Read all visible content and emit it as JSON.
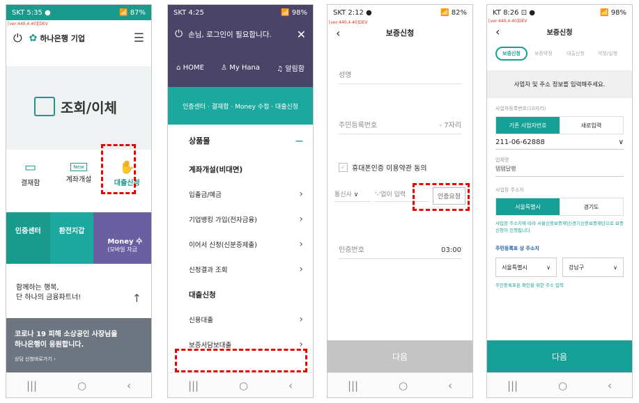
{
  "phone1": {
    "status": {
      "left": "SKT 5:35 ●",
      "right": "📶 87%"
    },
    "version": "[ver:440,4.40][DEV",
    "power_label": "⏻",
    "brand": "하나은행 기업",
    "menu_label": "☰",
    "hero_label": "조회/이체",
    "shortcuts": [
      "결재함",
      "계좌개설",
      "대출신청"
    ],
    "new_badge": "New",
    "tiles": [
      "인증센터",
      "환전지갑",
      "Money 수",
      "(모바일 자금"
    ],
    "slogan": [
      "함께하는 행복,",
      "단 하나의 금융파트너!"
    ],
    "up_label": "↑",
    "banner": [
      "코로나 19 피해 소상공인 사장님을",
      "하나은행이 응원합니다.",
      "상담 신청바로가기 ›"
    ]
  },
  "phone2": {
    "status": {
      "left": "SKT 4:25",
      "right": "📶 98%"
    },
    "login_msg": "손님, 로그인이 필요합니다.",
    "close_label": "✕",
    "quick": [
      "HOME",
      "My Hana",
      "알림함"
    ],
    "cert_bar": "인증센터 · 결재함 · Money 수첩 · 대출신청",
    "section1": "상품몰",
    "collapse": "—",
    "heading1": "계좌개설(비대면)",
    "items1": [
      "입출금/예금",
      "기업뱅킹 가입(전자금융)",
      "이어서 신청(신분증제출)",
      "신청결과 조회"
    ],
    "heading2": "대출신청",
    "items2": [
      "신용대출",
      "보증서담보대출"
    ]
  },
  "phone3": {
    "status": {
      "left": "SKT 2:12 ●",
      "right": "📶 82%"
    },
    "version": "[ver:440,4.40]DEV",
    "title": "보증신청",
    "name_ph": "성명",
    "rrn_ph": "주민등록번호",
    "rrn_back": "- 7자리",
    "agree": "휴대폰인증 이용약관 동의",
    "carrier": "통신사",
    "phone_ph": "'-'없이 입력",
    "verify_btn": "인증요청",
    "code_ph": "인증번호",
    "timer": "03:00",
    "next": "다음"
  },
  "phone4": {
    "status": {
      "left": "KT 8:26 ⊡ ●",
      "right": "📶 98%"
    },
    "version": "[ver:440,4.40]DEV",
    "title": "보증신청",
    "steps": [
      "보증신청",
      "보증약정",
      "대출신청",
      "약정/실행"
    ],
    "instruction": "사업자 및 주소 정보를 입력해주세요.",
    "biz_label": "사업자등록번호(10자리)",
    "biz_tabs": [
      "기존 사업자번호",
      "새로입력"
    ],
    "biz_value": "211-06-62888",
    "biz_name_label": "업체명",
    "biz_name": "탬탬달팽",
    "addr_label": "사업장 주소지",
    "addr_tabs": [
      "서울특별시",
      "경기도"
    ],
    "addr_note": "사업장 주소지에 따라 서울신용보증재단/경기신용보증재단으로 보증신청이 진행됩니다.",
    "res_label": "주민등록표 상 주소지",
    "city": "서울특별시",
    "district": "강남구",
    "res_note": "주민등록표본 확인을 위한 주소 입력",
    "next": "다음"
  },
  "colors": {
    "teal": "#1a9a8c",
    "purple": "#4a4468",
    "red": "#e00000"
  }
}
